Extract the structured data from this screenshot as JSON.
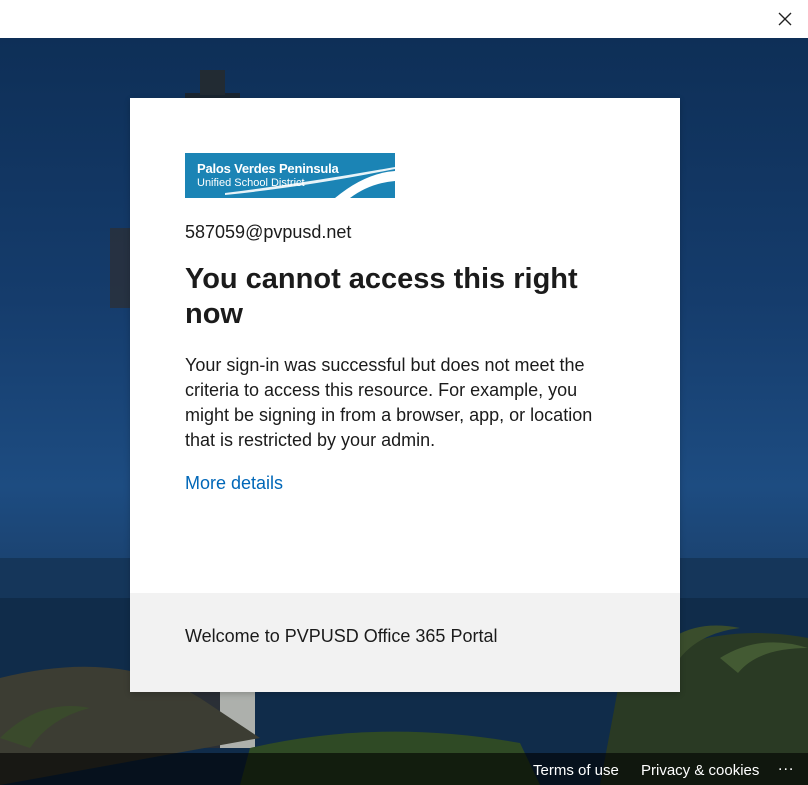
{
  "window": {
    "close_icon": "close-icon"
  },
  "card": {
    "logo": {
      "line1": "Palos Verdes Peninsula",
      "line2": "Unified School District",
      "color": "#1b84b5"
    },
    "email": "587059@pvpusd.net",
    "title": "You cannot access this right now",
    "description": "Your sign-in was successful but does not meet the criteria to access this resource. For example, you might be signing in from a browser, app, or location that is restricted by your admin.",
    "more_details_label": "More details",
    "footer_text": "Welcome to PVPUSD Office 365 Portal"
  },
  "footer": {
    "terms_label": "Terms of use",
    "privacy_label": "Privacy & cookies",
    "more_label": "..."
  },
  "colors": {
    "link": "#0067b8",
    "text": "#1b1b1b",
    "card_footer_bg": "#f2f2f2"
  }
}
